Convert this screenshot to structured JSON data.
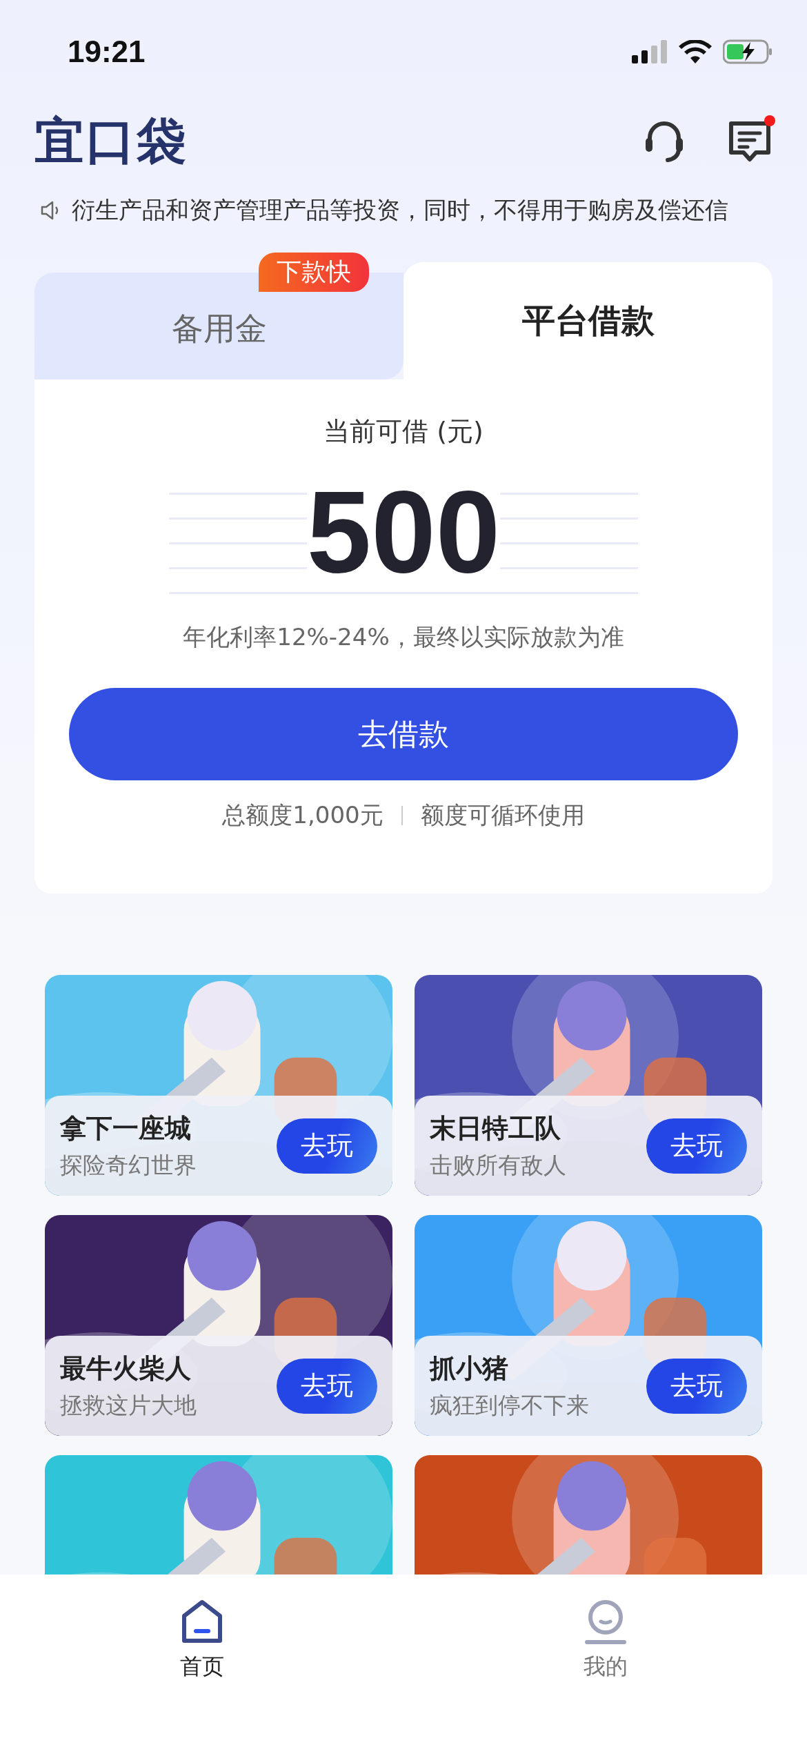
{
  "status_bar": {
    "time": "19:21"
  },
  "header": {
    "logo": "宜口袋",
    "has_unread_messages": true
  },
  "notice": {
    "text": "衍生产品和资产管理产品等投资，同时，不得用于购房及偿还信"
  },
  "tabs": [
    {
      "label": "备用金",
      "selected": false,
      "badge": "下款快"
    },
    {
      "label": "平台借款",
      "selected": true
    }
  ],
  "loan": {
    "label": "当前可借 (元)",
    "amount": "500",
    "rate_note": "年化利率12%-24%，最终以实际放款为准",
    "button": "去借款",
    "total": "总额度1,000元",
    "cycle_note": "额度可循环使用"
  },
  "games": [
    {
      "title": "拿下一座城",
      "subtitle": "探险奇幻世界",
      "button": "去玩",
      "color": "#5cc3ee"
    },
    {
      "title": "末日特工队",
      "subtitle": "击败所有敌人",
      "button": "去玩",
      "color": "#4a4fb0"
    },
    {
      "title": "最牛火柴人",
      "subtitle": "拯救这片大地",
      "button": "去玩",
      "color": "#3a2360"
    },
    {
      "title": "抓小猪",
      "subtitle": "疯狂到停不下来",
      "button": "去玩",
      "color": "#3aa0f5"
    },
    {
      "color": "#2fc4d8"
    },
    {
      "color": "#c94a1a"
    }
  ],
  "bottom_nav": [
    {
      "label": "首页",
      "selected": true
    },
    {
      "label": "我的",
      "selected": false
    }
  ]
}
